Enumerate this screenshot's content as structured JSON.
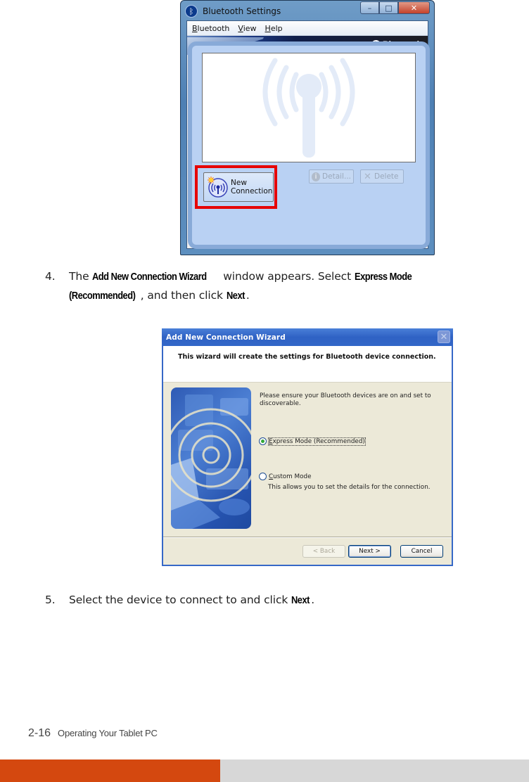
{
  "bluetooth_settings": {
    "title": "Bluetooth Settings",
    "menu": [
      {
        "label": "Bluetooth",
        "accel": "B",
        "rest": "luetooth"
      },
      {
        "label": "View",
        "accel": "V",
        "rest": "iew"
      },
      {
        "label": "Help",
        "accel": "H",
        "rest": "elp"
      }
    ],
    "brand": "Bluetooth",
    "window_controls": {
      "minimize": "–",
      "maximize": "□",
      "close": "✕"
    },
    "new_connection_label_1": "New",
    "new_connection_label_2": "Connection",
    "detail_label": "Detail...",
    "delete_label": "Delete",
    "highlight_color": "#e60000"
  },
  "steps": [
    {
      "number": "4.",
      "line1_pre": "The ",
      "line1_kw1": "Add New Connection Wizard",
      "line1_mid": " window appears. Select ",
      "line1_kw2": "Express Mode",
      "line2_kw": "(Recommended)",
      "line2_mid": ", and then click ",
      "line2_kw2": "Next",
      "line2_end": "."
    },
    {
      "number": "5.",
      "pre": "Select the device to connect to and click ",
      "kw": "Next",
      "end": "."
    }
  ],
  "wizard": {
    "title": "Add New Connection Wizard",
    "close": "✕",
    "header": "This wizard will create the settings for Bluetooth device connection.",
    "instruction": "Please ensure your Bluetooth devices are on and set to discoverable.",
    "options": [
      {
        "accel": "E",
        "rest": "xpress Mode (Recommended)",
        "selected": true
      },
      {
        "accel": "C",
        "rest": "ustom Mode",
        "selected": false
      }
    ],
    "custom_desc": "This allows you to set the details for the connection.",
    "buttons": {
      "back": "< Back",
      "next": "Next >",
      "cancel": "Cancel"
    }
  },
  "footer": {
    "page_number": "2-16",
    "chapter": "Operating Your Tablet PC",
    "accent_color": "#d4480f",
    "bar_gray": "#d7d7d7"
  }
}
